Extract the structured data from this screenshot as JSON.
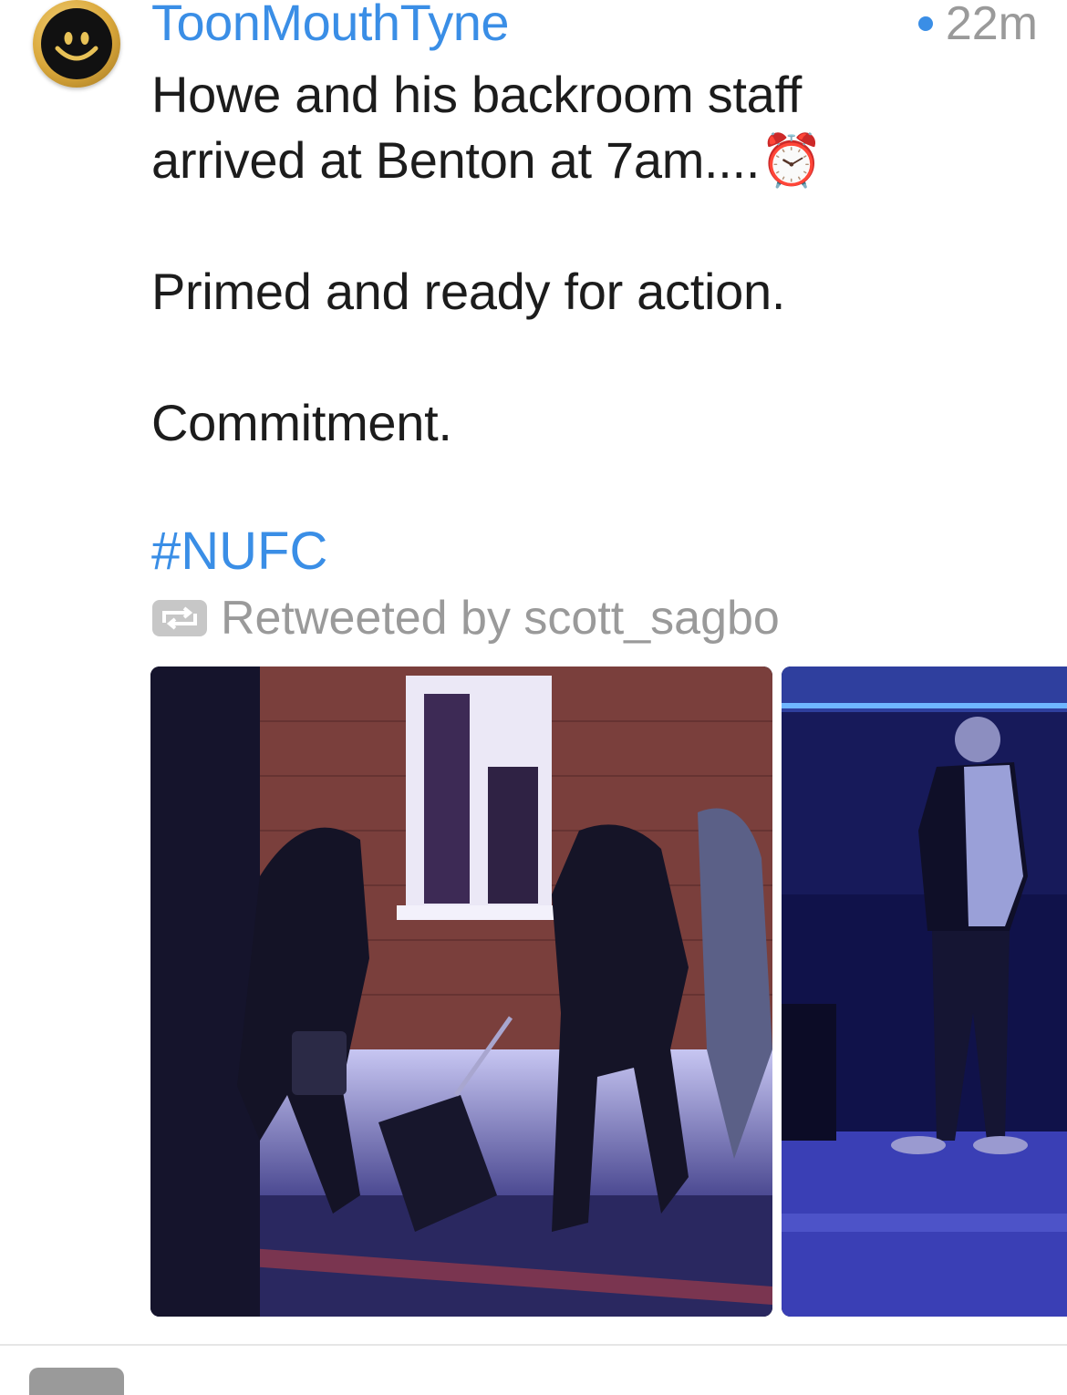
{
  "tweet": {
    "author": "ToonMouthTyne",
    "timestamp": "22m",
    "lines": [
      "Howe and his backroom staff",
      "arrived at Benton at 7am....⏰",
      "Primed and ready for action.",
      "Commitment."
    ],
    "hashtag": "#NUFC",
    "retweet_label": "Retweeted by scott_sagbo"
  },
  "colors": {
    "link_blue": "#3a8ee6",
    "meta_gray": "#9a9a9a",
    "text": "#1c1c1c"
  },
  "icons": {
    "avatar": "smiley-face-avatar",
    "retweet": "retweet-icon",
    "alarm": "alarm-clock-emoji"
  }
}
